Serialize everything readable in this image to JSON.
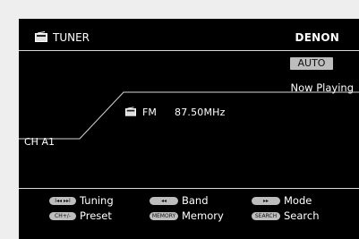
{
  "header": {
    "icon": "radio-icon",
    "title": "TUNER",
    "brand": "DENON"
  },
  "status": {
    "mode_badge": "AUTO",
    "now_playing": "Now Playing"
  },
  "station": {
    "icon": "radio-icon",
    "band": "FM",
    "frequency": "87.50MHz",
    "channel": "CH A1"
  },
  "controls": [
    {
      "key": "I◂◂ ▸▸I",
      "label": "Tuning"
    },
    {
      "key": "◂◂",
      "label": "Band"
    },
    {
      "key": "▸▸",
      "label": "Mode"
    },
    {
      "key": "CH+/-",
      "label": "Preset"
    },
    {
      "key": "MEMORY",
      "label": "Memory"
    },
    {
      "key": "SEARCH",
      "label": "Search"
    }
  ],
  "colors": {
    "screen": "#000000",
    "text": "#ffffff",
    "badge": "#bdbdbd",
    "frame": "#eeeeee"
  }
}
